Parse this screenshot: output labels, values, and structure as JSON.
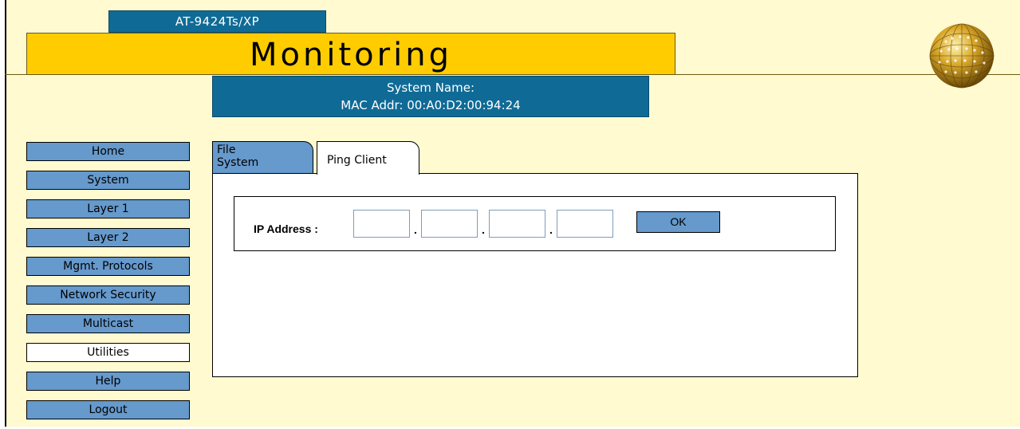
{
  "header": {
    "model": "AT-9424Ts/XP",
    "section_title": "Monitoring",
    "system_name_line": "System Name:",
    "mac_line": "MAC Addr: 00:A0:D2:00:94:24"
  },
  "nav": {
    "items": [
      {
        "label": "Home"
      },
      {
        "label": "System"
      },
      {
        "label": "Layer 1"
      },
      {
        "label": "Layer 2"
      },
      {
        "label": "Mgmt. Protocols"
      },
      {
        "label": "Network Security"
      },
      {
        "label": "Multicast"
      },
      {
        "label": "Utilities",
        "active": true
      },
      {
        "label": "Help"
      },
      {
        "label": "Logout"
      }
    ]
  },
  "tabs": [
    {
      "label": "File\nSystem"
    },
    {
      "label": "Ping Client",
      "active": true
    }
  ],
  "form": {
    "ip_label": "IP Address :",
    "octets": [
      "",
      "",
      "",
      ""
    ],
    "separator": ".",
    "ok_label": "OK"
  },
  "colors": {
    "background": "#fffad0",
    "header_blue": "#0f6b96",
    "title_gold": "#ffcc00",
    "nav_blue": "#6699cc"
  }
}
